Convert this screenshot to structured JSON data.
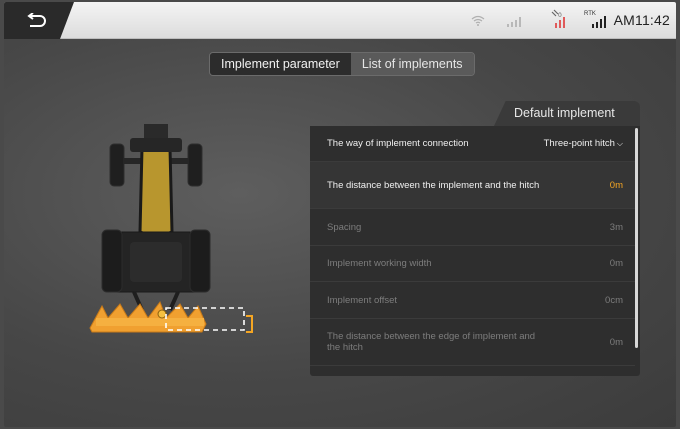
{
  "status_bar": {
    "time": "AM11:42",
    "rtk_label": "RTK",
    "icons": [
      "back-icon",
      "wifi-icon",
      "cellular-signal-icon",
      "satellite-signal-icon",
      "rtk-signal-icon"
    ]
  },
  "tabs": [
    {
      "label": "Implement parameter",
      "active": true
    },
    {
      "label": "List of implements",
      "active": false
    }
  ],
  "panel": {
    "title": "Default implement",
    "rows": [
      {
        "label": "The way of implement connection",
        "value": "Three-point hitch",
        "state": "normal"
      },
      {
        "label": "The distance between the implement and the hitch",
        "value": "0m",
        "state": "selected"
      },
      {
        "label": "Spacing",
        "value": "3m",
        "state": "dim"
      },
      {
        "label": "Implement working width",
        "value": "0m",
        "state": "dim"
      },
      {
        "label": "Implement offset",
        "value": "0cm",
        "state": "dim"
      },
      {
        "label": "The distance between the edge of implement and the hitch",
        "value": "0m",
        "state": "dim"
      }
    ]
  },
  "colors": {
    "accent": "#f5a623",
    "panel_bg": "#2e2e2e",
    "tab_active_bg": "#2c2c2c"
  }
}
